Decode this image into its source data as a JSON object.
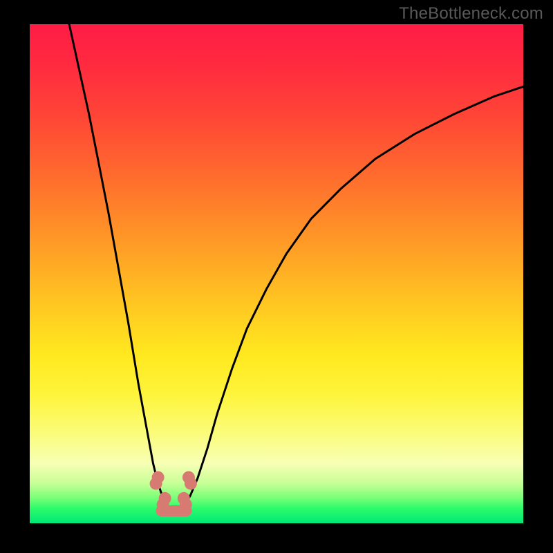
{
  "watermark": "TheBottleneck.com",
  "chart_data": {
    "type": "line",
    "title": "",
    "xlabel": "",
    "ylabel": "",
    "xlim": [
      0,
      100
    ],
    "ylim": [
      0,
      100
    ],
    "grid": false,
    "legend": false,
    "series": [
      {
        "name": "left-branch",
        "color": "#000000",
        "x": [
          8,
          10,
          12,
          14,
          16,
          18,
          20,
          22,
          23.5,
          25,
          26,
          27,
          28
        ],
        "values": [
          100,
          91,
          82,
          72,
          62,
          51,
          40,
          28,
          20,
          12,
          8,
          5,
          3.2
        ]
      },
      {
        "name": "right-branch",
        "color": "#000000",
        "x": [
          31,
          32.5,
          34,
          36,
          38,
          41,
          44,
          48,
          52,
          57,
          63,
          70,
          78,
          86,
          94,
          100
        ],
        "values": [
          3.2,
          5.5,
          9,
          15,
          22,
          31,
          39,
          47,
          54,
          61,
          67,
          73,
          78,
          82,
          85.5,
          87.5
        ]
      },
      {
        "name": "bottom-bridge",
        "color": "#000000",
        "x": [
          28,
          29,
          30,
          31
        ],
        "values": [
          3.2,
          2.8,
          2.8,
          3.2
        ]
      }
    ],
    "markers": [
      {
        "name": "left-dumbbell-top",
        "x": 26.0,
        "y": 9.2,
        "shape": "blob",
        "color": "#d77a72"
      },
      {
        "name": "left-dumbbell-bottom",
        "x": 27.4,
        "y": 5.0,
        "shape": "blob",
        "color": "#d77a72"
      },
      {
        "name": "right-dumbbell-top",
        "x": 32.2,
        "y": 9.2,
        "shape": "blob",
        "color": "#d77a72"
      },
      {
        "name": "right-dumbbell-bottom",
        "x": 31.2,
        "y": 5.0,
        "shape": "blob",
        "color": "#d77a72"
      },
      {
        "name": "bottom-pill",
        "x": 29.2,
        "y": 2.5,
        "shape": "pill",
        "color": "#d77a72"
      }
    ],
    "colors": {
      "frame": "#000000",
      "gradient_top": "#ff1c46",
      "gradient_mid": "#ffe81f",
      "gradient_bottom": "#00e876",
      "marker": "#d77a72"
    }
  }
}
